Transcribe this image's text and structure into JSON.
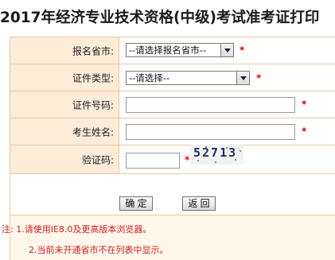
{
  "title": "2017年经济专业技术资格(中级)考试准考证打印",
  "form": {
    "province": {
      "label": "报名省市:",
      "value": "--请选择报名省市--",
      "required_mark": "*"
    },
    "cert_type": {
      "label": "证件类型:",
      "value": "--请选择--",
      "required_mark": "*"
    },
    "cert_no": {
      "label": "证件号码:",
      "value": "",
      "required_mark": "*"
    },
    "name": {
      "label": "考生姓名:",
      "value": "",
      "required_mark": "*"
    },
    "captcha": {
      "label": "验证码:",
      "value": "",
      "required_mark": "*",
      "image_text": "52713"
    }
  },
  "buttons": {
    "confirm": "确 定",
    "back": "返 回"
  },
  "notes": {
    "line1": "注: 1.请使用IE8.0及更高版本浏览器。",
    "line2": "2.当前未开通省市不在列表中显示。"
  },
  "colors": {
    "label_bg": "#fdecd8",
    "border": "#e9c9a3",
    "required": "#e00000",
    "note": "#cc1f1f"
  }
}
